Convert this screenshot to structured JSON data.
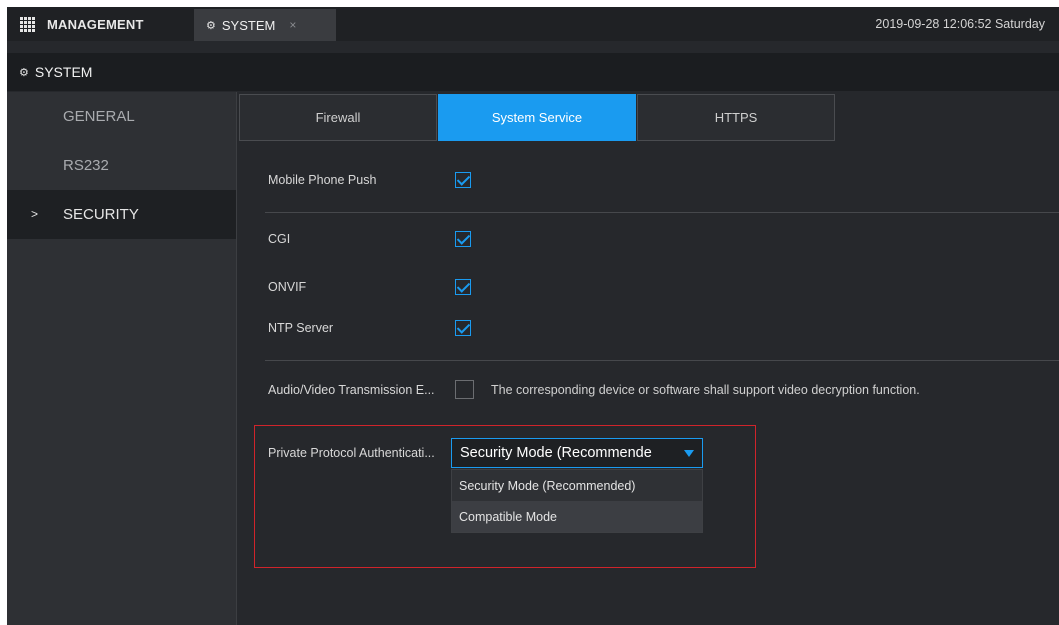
{
  "topbar": {
    "management_label": "MANAGEMENT",
    "tab_label": "SYSTEM",
    "tab_close": "×",
    "datetime": "2019-09-28 12:06:52 Saturday"
  },
  "section_title": "SYSTEM",
  "sidebar": {
    "items": [
      {
        "label": "GENERAL"
      },
      {
        "label": "RS232"
      },
      {
        "label": "SECURITY",
        "active": true
      }
    ]
  },
  "tabs": [
    {
      "label": "Firewall"
    },
    {
      "label": "System Service",
      "active": true
    },
    {
      "label": "HTTPS"
    }
  ],
  "settings": {
    "mobile_push": {
      "label": "Mobile Phone Push",
      "checked": true
    },
    "cgi": {
      "label": "CGI",
      "checked": true
    },
    "onvif": {
      "label": "ONVIF",
      "checked": true
    },
    "ntp": {
      "label": "NTP Server",
      "checked": true
    },
    "av_encrypt": {
      "label": "Audio/Video Transmission E...",
      "checked": false,
      "note": "The corresponding device or software shall support video decryption function."
    },
    "private_auth": {
      "label": "Private Protocol Authenticati...",
      "selected": "Security Mode (Recommende",
      "options": [
        "Security Mode (Recommended)",
        "Compatible Mode"
      ]
    }
  },
  "colors": {
    "accent": "#1a9bf0",
    "highlight_box": "#d0242b"
  }
}
